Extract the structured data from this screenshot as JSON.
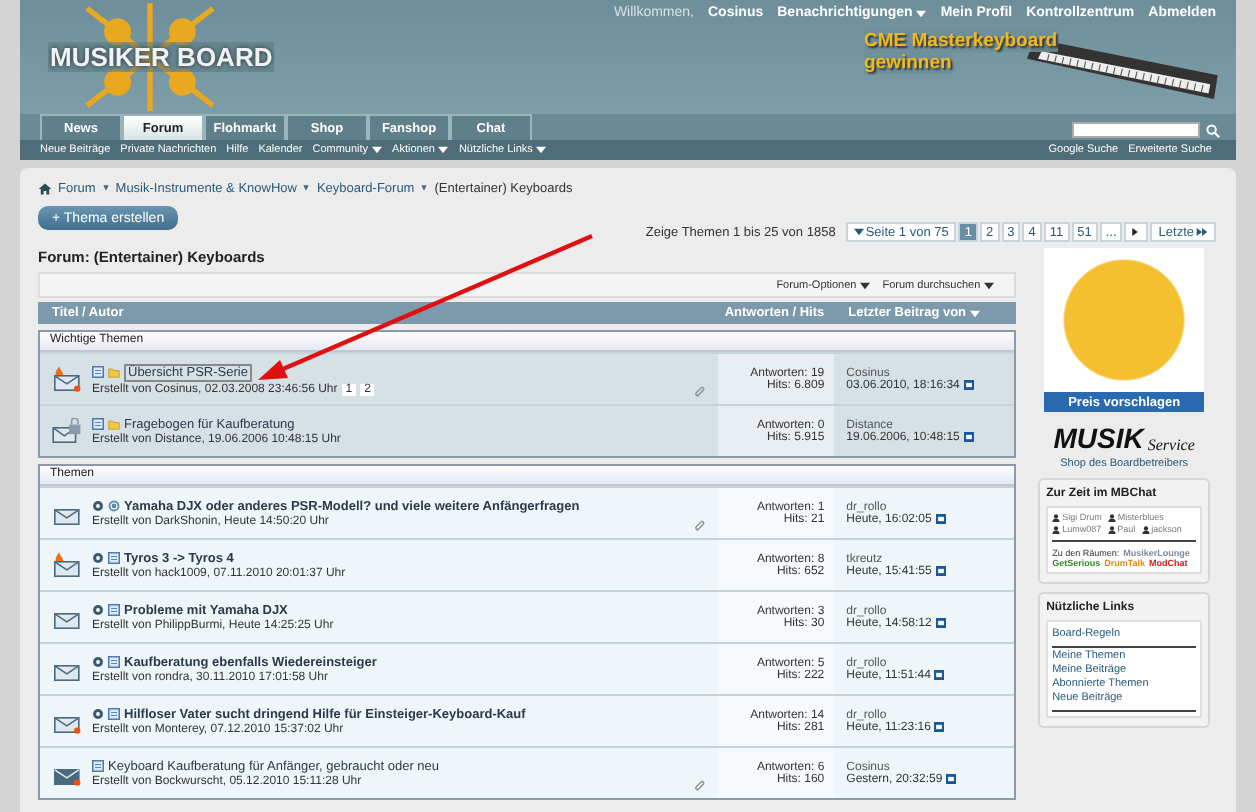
{
  "header": {
    "logo": "MUSIKER BOARD",
    "welcome": "Willkommen,",
    "user_links": [
      {
        "label": "Cosinus",
        "menu": false
      },
      {
        "label": "Benachrichtigungen",
        "menu": true
      },
      {
        "label": "Mein Profil",
        "menu": false
      },
      {
        "label": "Kontrollzentrum",
        "menu": false
      },
      {
        "label": "Abmelden",
        "menu": false
      }
    ],
    "ad": [
      "CME Masterkeyboard",
      "gewinnen"
    ]
  },
  "tabs": [
    {
      "label": "News",
      "selected": false
    },
    {
      "label": "Forum",
      "selected": true
    },
    {
      "label": "Flohmarkt",
      "selected": false
    },
    {
      "label": "Shop",
      "selected": false
    },
    {
      "label": "Fanshop",
      "selected": false
    },
    {
      "label": "Chat",
      "selected": false
    }
  ],
  "subnav": [
    {
      "label": "Neue Beiträge",
      "menu": false
    },
    {
      "label": "Private Nachrichten",
      "menu": false
    },
    {
      "label": "Hilfe",
      "menu": false
    },
    {
      "label": "Kalender",
      "menu": false
    },
    {
      "label": "Community",
      "menu": true
    },
    {
      "label": "Aktionen",
      "menu": true
    },
    {
      "label": "Nützliche Links",
      "menu": true
    }
  ],
  "search_links": [
    "Google Suche",
    "Erweiterte Suche"
  ],
  "breadcrumb": [
    "Forum",
    "Musik-Instrumente & KnowHow",
    "Keyboard-Forum",
    "(Entertainer) Keyboards"
  ],
  "new_thread_button": "+ Thema erstellen",
  "pagination": {
    "summary": "Zeige Themen 1 bis 25 von 1858",
    "page_menu": "Seite 1 von 75",
    "pages": [
      {
        "label": "1",
        "selected": true
      },
      {
        "label": "2",
        "selected": false
      },
      {
        "label": "3",
        "selected": false
      },
      {
        "label": "4",
        "selected": false
      },
      {
        "label": "11",
        "selected": false
      },
      {
        "label": "51",
        "selected": false
      },
      {
        "label": "...",
        "selected": false
      }
    ],
    "last": "Letzte"
  },
  "forum_title": "Forum: (Entertainer) Keyboards",
  "options": [
    "Forum-Optionen",
    "Forum durchsuchen"
  ],
  "columns": {
    "title": "Titel / Autor",
    "stats": "Antworten / Hits",
    "last": "Letzter Beitrag von"
  },
  "sections": [
    {
      "title": "Wichtige Themen",
      "rows": [
        {
          "kind": "hot",
          "unread": true,
          "tools": false,
          "folder": true,
          "question": false,
          "bold": false,
          "highlight": true,
          "title": "Übersicht PSR-Serie",
          "author": "Erstellt von Cosinus, 02.03.2008 23:46:56 Uhr",
          "pages": [
            "1",
            "2"
          ],
          "attachment": true,
          "replies": "Antworten: 19",
          "hits": "Hits: 6.809",
          "last_user": "Cosinus",
          "last_date": "03.06.2010, 18:16:34"
        },
        {
          "kind": "locked",
          "unread": false,
          "tools": false,
          "folder": true,
          "question": false,
          "bold": false,
          "highlight": false,
          "title": "Fragebogen für Kaufberatung",
          "author": "Erstellt von Distance, 19.06.2006 10:48:15 Uhr",
          "pages": [],
          "attachment": false,
          "replies": "Antworten: 0",
          "hits": "Hits: 5.915",
          "last_user": "Distance",
          "last_date": "19.06.2006, 10:48:15"
        }
      ]
    },
    {
      "title": "Themen",
      "rows": [
        {
          "kind": "normal",
          "unread": false,
          "tools": true,
          "folder": false,
          "question": true,
          "bold": true,
          "highlight": false,
          "title": "Yamaha DJX oder anderes PSR-Modell? und viele weitere Anfängerfragen",
          "author": "Erstellt von DarkShonin, Heute 14:50:20 Uhr",
          "pages": [],
          "attachment": true,
          "replies": "Antworten: 1",
          "hits": "Hits: 21",
          "last_user": "dr_rollo",
          "last_date": "Heute, 16:02:05"
        },
        {
          "kind": "hot",
          "unread": false,
          "tools": true,
          "folder": false,
          "question": false,
          "bold": true,
          "highlight": false,
          "title": "Tyros 3 -> Tyros 4",
          "author": "Erstellt von hack1009, 07.11.2010 20:01:37 Uhr",
          "pages": [],
          "attachment": false,
          "replies": "Antworten: 8",
          "hits": "Hits: 652",
          "last_user": "tkreutz",
          "last_date": "Heute, 15:41:55"
        },
        {
          "kind": "normal",
          "unread": false,
          "tools": true,
          "folder": false,
          "question": false,
          "bold": true,
          "highlight": false,
          "title": "Probleme mit Yamaha DJX",
          "author": "Erstellt von PhilippBurmi, Heute 14:25:25 Uhr",
          "pages": [],
          "attachment": false,
          "replies": "Antworten: 3",
          "hits": "Hits: 30",
          "last_user": "dr_rollo",
          "last_date": "Heute, 14:58:12"
        },
        {
          "kind": "normal",
          "unread": false,
          "tools": true,
          "folder": false,
          "question": false,
          "bold": true,
          "highlight": false,
          "title": "Kaufberatung ebenfalls Wiedereinsteiger",
          "author": "Erstellt von rondra, 30.11.2010 17:01:58 Uhr",
          "pages": [],
          "attachment": false,
          "replies": "Antworten: 5",
          "hits": "Hits: 222",
          "last_user": "dr_rollo",
          "last_date": "Heute, 11:51:44"
        },
        {
          "kind": "normal",
          "unread": true,
          "tools": true,
          "folder": false,
          "question": false,
          "bold": true,
          "highlight": false,
          "title": "Hilfloser Vater sucht dringend Hilfe für Einsteiger-Keyboard-Kauf",
          "author": "Erstellt von Monterey, 07.12.2010 15:37:02 Uhr",
          "pages": [],
          "attachment": false,
          "replies": "Antworten: 14",
          "hits": "Hits: 281",
          "last_user": "dr_rollo",
          "last_date": "Heute, 11:23:16"
        },
        {
          "kind": "read",
          "unread": true,
          "tools": false,
          "folder": false,
          "question": false,
          "bold": false,
          "highlight": false,
          "title": "Keyboard Kaufberatung für Anfänger, gebraucht oder neu",
          "author": "Erstellt von Bockwurscht, 05.12.2010 15:11:28 Uhr",
          "pages": [],
          "attachment": true,
          "replies": "Antworten: 6",
          "hits": "Hits: 160",
          "last_user": "Cosinus",
          "last_date": "Gestern, 20:32:59"
        }
      ]
    }
  ],
  "sidebar": {
    "ad_button": "Preis vorschlagen",
    "shop_logo": [
      "MUSIK",
      "Service"
    ],
    "shop_caption": "Shop des Boardbetreibers",
    "chat": {
      "title": "Zur Zeit im MBChat",
      "users": [
        "Sigi Drum",
        "Misterblues",
        "Lumw087",
        "Paul",
        "jackson"
      ],
      "rooms_label": "Zu den Räumen:",
      "rooms": [
        {
          "name": "MusikerLounge",
          "color": "#7a8a9a"
        },
        {
          "name": "GetSerious",
          "color": "#3a8a2a"
        },
        {
          "name": "DrumTalk",
          "color": "#e08a10"
        },
        {
          "name": "ModChat",
          "color": "#d02020"
        }
      ]
    },
    "links": {
      "title": "Nützliche Links",
      "groups": [
        [
          "Board-Regeln"
        ],
        [
          "Meine Themen",
          "Meine Beiträge",
          "Abonnierte Themen",
          "Neue Beiträge"
        ]
      ]
    }
  }
}
